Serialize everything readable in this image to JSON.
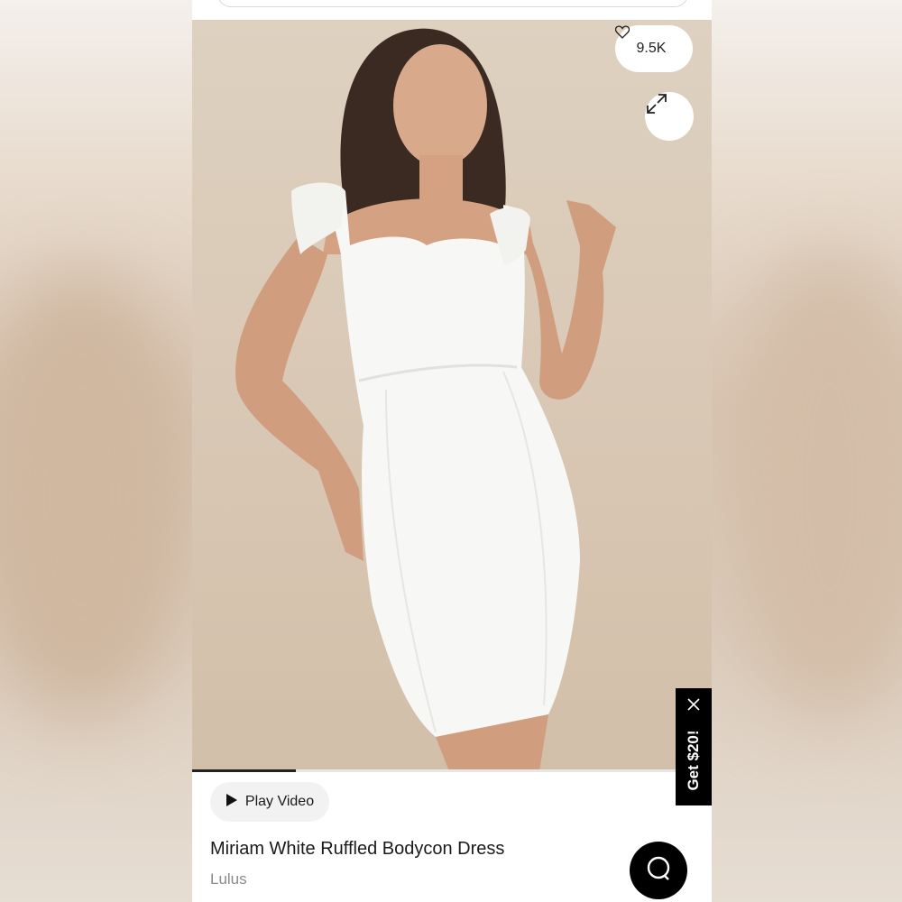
{
  "product": {
    "title": "Miriam White Ruffled Bodycon Dress",
    "brand": "Lulus",
    "likes": "9.5K"
  },
  "media": {
    "play_label": "Play Video",
    "progress_fraction": 0.2
  },
  "promo": {
    "label": "Get $20!"
  },
  "icons": {
    "heart": "heart-icon",
    "expand": "expand-icon",
    "play": "play-icon",
    "close": "close-icon",
    "chat": "chat-icon"
  },
  "colors": {
    "accent": "#000000",
    "background": "#ffffff",
    "photo_backdrop": "#dccbb8",
    "dress": "#ffffff"
  }
}
